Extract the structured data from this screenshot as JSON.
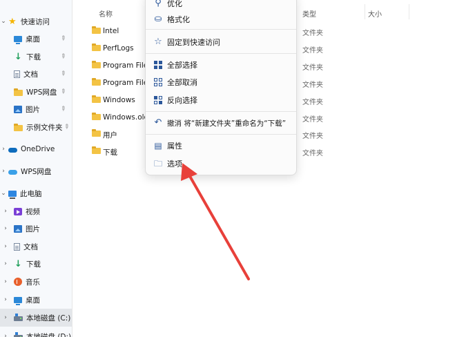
{
  "sidebar": {
    "items": [
      {
        "label": "快速访问",
        "icon": "star-icon"
      },
      {
        "label": "桌面",
        "icon": "desktop-icon"
      },
      {
        "label": "下载",
        "icon": "download-icon"
      },
      {
        "label": "文档",
        "icon": "document-icon"
      },
      {
        "label": "WPS网盘",
        "icon": "folder-icon"
      },
      {
        "label": "图片",
        "icon": "pictures-icon"
      },
      {
        "label": "示例文件夹",
        "icon": "folder-icon"
      },
      {
        "label": "OneDrive",
        "icon": "onedrive-cloud-icon"
      },
      {
        "label": "WPS网盘",
        "icon": "wps-cloud-icon"
      },
      {
        "label": "此电脑",
        "icon": "this-pc-icon"
      },
      {
        "label": "视频",
        "icon": "videos-icon"
      },
      {
        "label": "图片",
        "icon": "pictures-icon"
      },
      {
        "label": "文档",
        "icon": "document-icon"
      },
      {
        "label": "下载",
        "icon": "download-icon"
      },
      {
        "label": "音乐",
        "icon": "music-icon"
      },
      {
        "label": "桌面",
        "icon": "desktop-icon"
      },
      {
        "label": "本地磁盘 (C:)",
        "icon": "drive-icon"
      },
      {
        "label": "本地磁盘 (D:)",
        "icon": "drive-icon"
      }
    ]
  },
  "header": {
    "name": "名称",
    "type": "类型",
    "size": "大小"
  },
  "files": [
    {
      "name": "Intel",
      "type": "文件夹"
    },
    {
      "name": "PerfLogs",
      "type": "文件夹"
    },
    {
      "name": "Program Files",
      "type": "文件夹"
    },
    {
      "name": "Program Files",
      "type": "文件夹"
    },
    {
      "name": "Windows",
      "type": "文件夹"
    },
    {
      "name": "Windows.old",
      "type": "文件夹"
    },
    {
      "name": "用户",
      "type": "文件夹"
    },
    {
      "name": "下载",
      "type": "文件夹"
    }
  ],
  "context_menu": {
    "items": [
      {
        "label": "优化",
        "icon": "wrench-icon"
      },
      {
        "label": "格式化",
        "icon": "format-icon"
      },
      {
        "label": "固定到快速访问",
        "icon": "star-outline-icon"
      },
      {
        "label": "全部选择",
        "icon": "select-all-icon"
      },
      {
        "label": "全部取消",
        "icon": "select-none-icon"
      },
      {
        "label": "反向选择",
        "icon": "invert-selection-icon"
      },
      {
        "label": "撤消 将“新建文件夹”重命名为“下载”",
        "icon": "undo-icon"
      },
      {
        "label": "属性",
        "icon": "properties-icon"
      },
      {
        "label": "选项",
        "icon": "folder-options-icon"
      }
    ]
  },
  "colors": {
    "accent": "#2b579a",
    "annotation_arrow": "#e8403a",
    "folder": "#f3c344"
  }
}
